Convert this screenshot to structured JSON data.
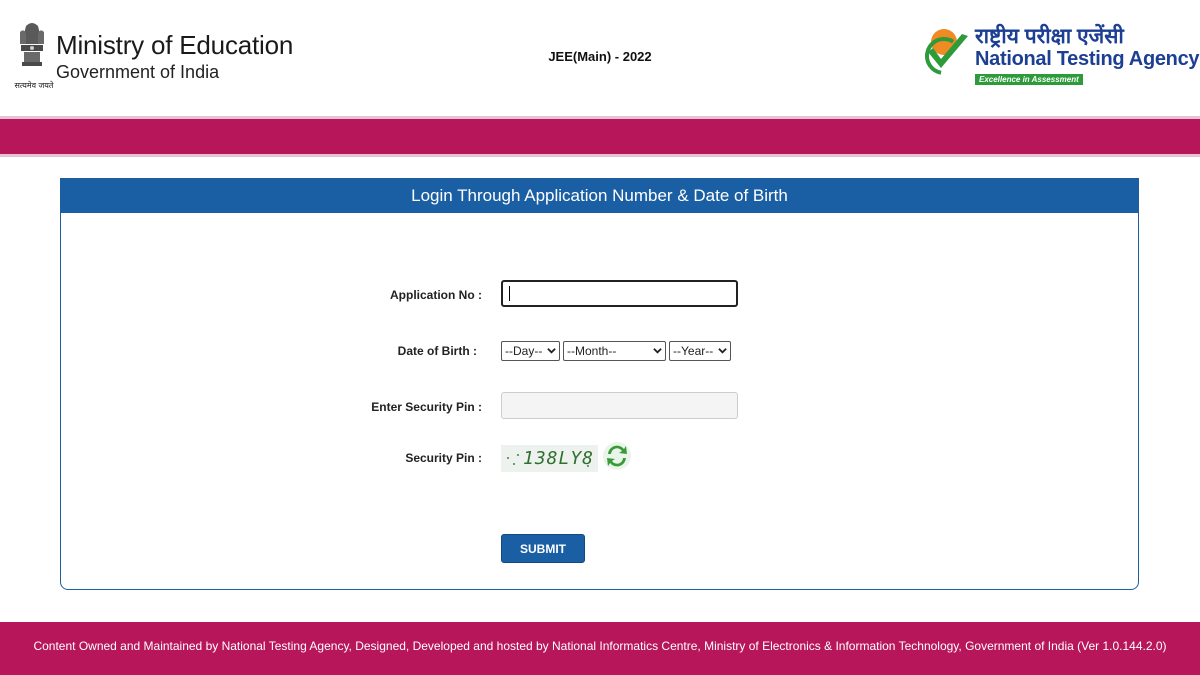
{
  "header": {
    "emblem_caption": "सत्यमेव जयते",
    "ministry_title": "Ministry of Education",
    "ministry_subtitle": "Government of India",
    "exam_title": "JEE(Main) - 2022",
    "agency_hindi": "राष्ट्रीय परीक्षा एजेंसी",
    "agency_name": "National Testing Agency",
    "agency_tagline": "Excellence in Assessment"
  },
  "login": {
    "title": "Login Through Application Number & Date of Birth",
    "application_no_label": "Application No :",
    "application_no_value": "",
    "dob_label": "Date of Birth :",
    "day_selected": "--Day--",
    "month_selected": "--Month--",
    "year_selected": "--Year--",
    "enter_pin_label": "Enter Security Pin :",
    "enter_pin_value": "",
    "security_pin_label": "Security Pin :",
    "captcha_text": "138LY8",
    "submit_label": "SUBMIT"
  },
  "footer": {
    "text": "Content Owned and Maintained by National Testing Agency, Designed, Developed and hosted by National Informatics Centre, Ministry of Electronics & Information Technology, Government of India (Ver 1.0.144.2.0)"
  },
  "colors": {
    "brand_magenta": "#b8165a",
    "header_blue": "#1a5ea3",
    "agency_blue": "#1c3f94",
    "tagline_green": "#2e9b3a"
  },
  "icons": {
    "emblem": "national-emblem-icon",
    "agency_logo": "nta-check-logo-icon",
    "refresh": "refresh-icon",
    "dropdown": "chevron-down-icon"
  }
}
